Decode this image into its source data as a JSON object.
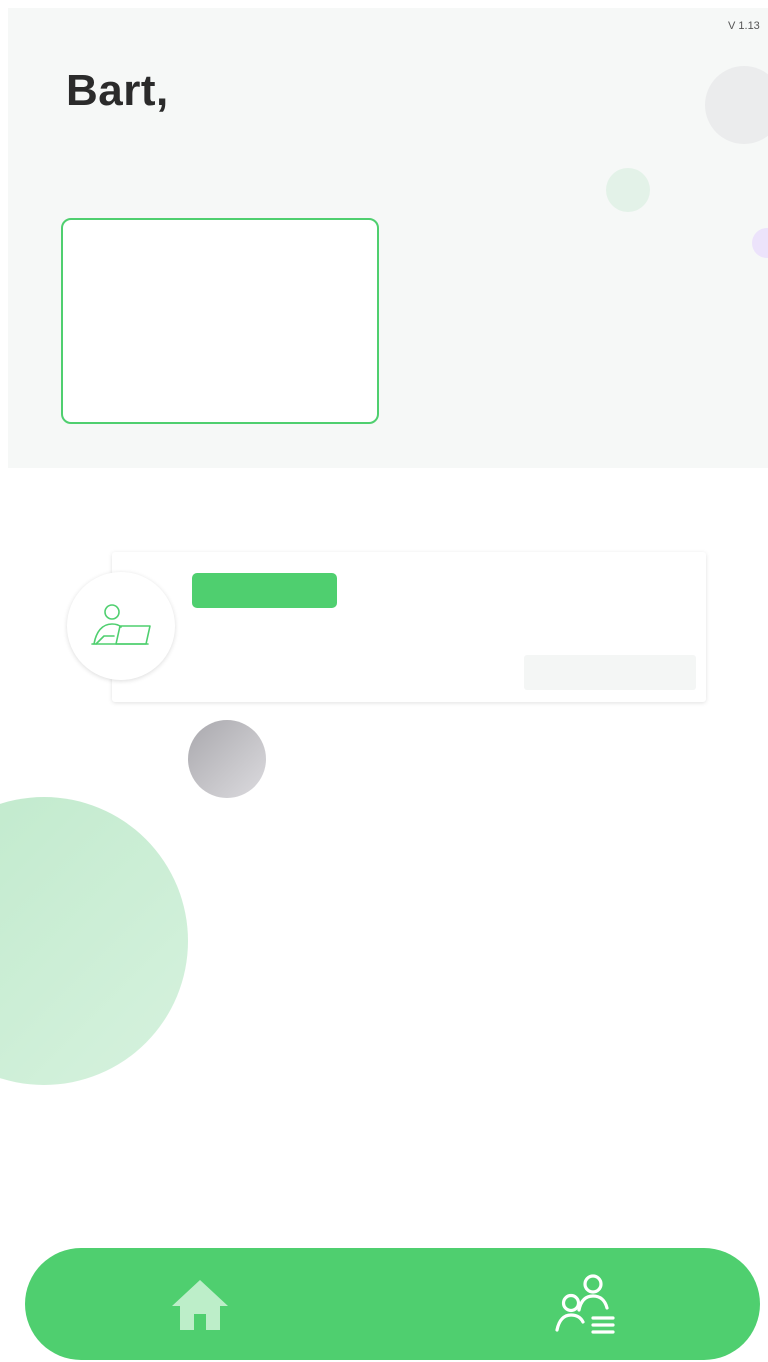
{
  "app": {
    "version": "V 1.13"
  },
  "header": {
    "greeting": "Bart,"
  },
  "colors": {
    "accent": "#4fcf6f",
    "header_bg": "#f6f8f7",
    "decor_green": "#bfe9cb",
    "decor_grey": "#b7b6bb",
    "decor_lilac": "#ece3fb"
  },
  "task_card": {
    "icon": "person-laptop-icon"
  },
  "bottom_nav": {
    "items": [
      {
        "icon": "home-icon"
      },
      {
        "icon": "people-list-icon"
      }
    ]
  }
}
